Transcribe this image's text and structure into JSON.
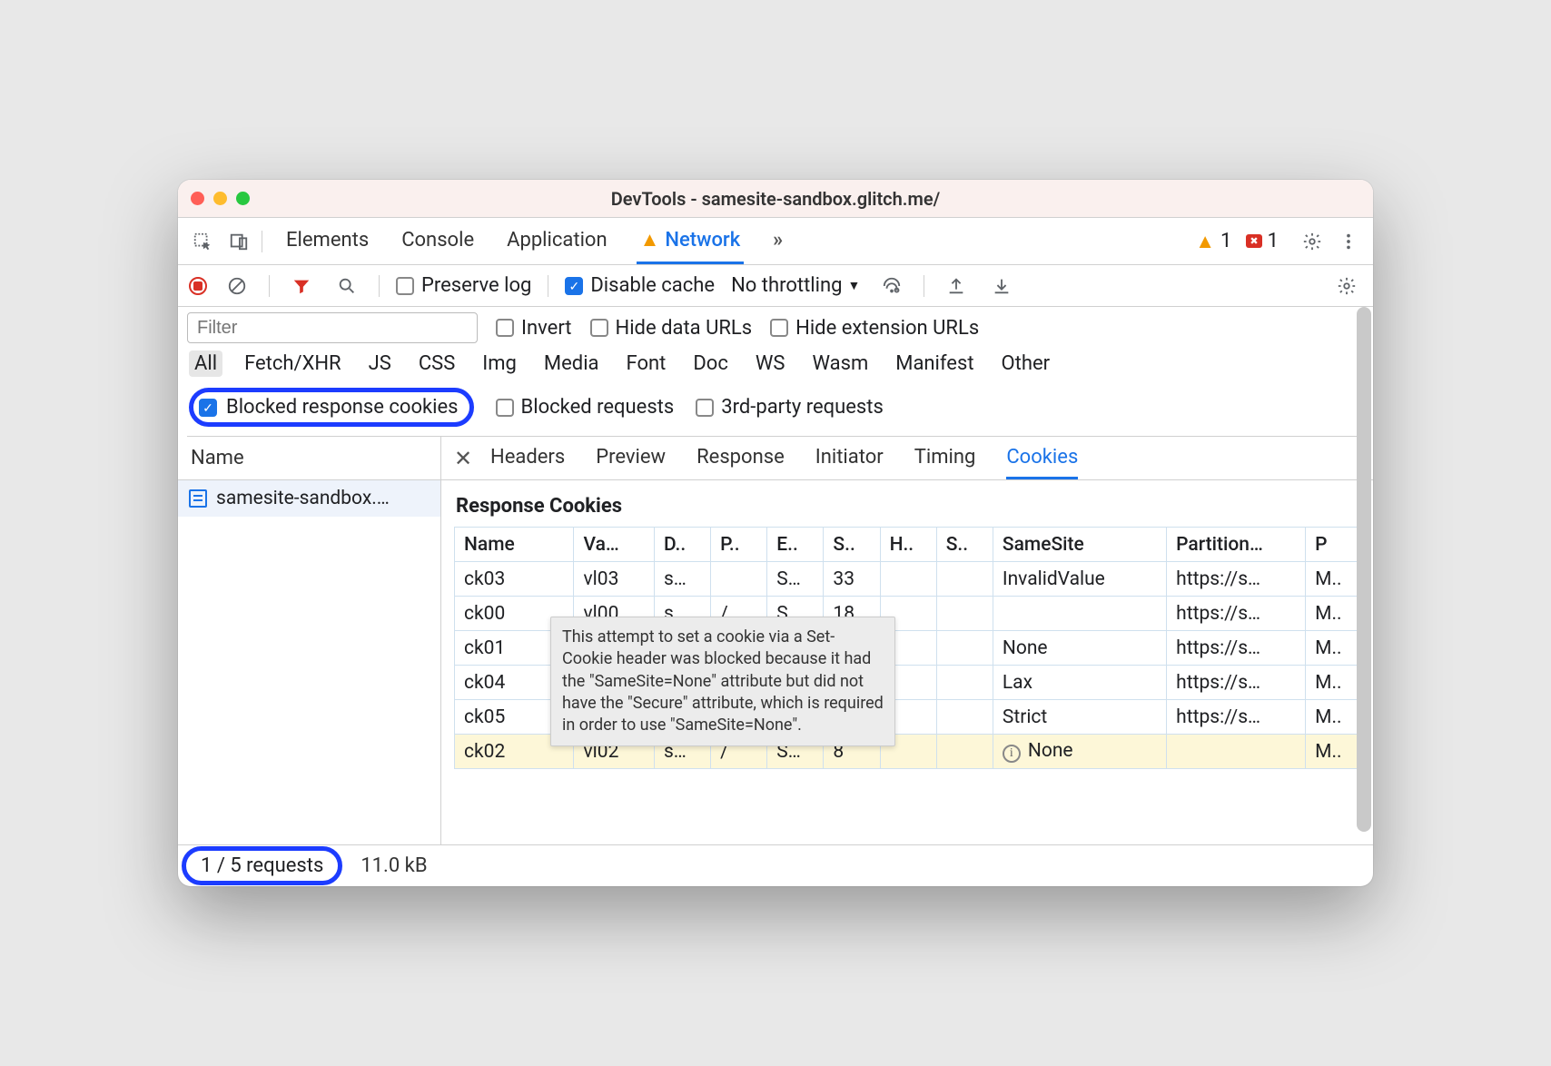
{
  "window": {
    "title": "DevTools - samesite-sandbox.glitch.me/"
  },
  "panel_tabs": {
    "items": [
      "Elements",
      "Console",
      "Application",
      "Network"
    ],
    "active": "Network",
    "more": "»",
    "warn_count": "1",
    "error_count": "1"
  },
  "net_toolbar": {
    "preserve_log": "Preserve log",
    "disable_cache": "Disable cache",
    "throttling": "No throttling"
  },
  "filters": {
    "placeholder": "Filter",
    "invert": "Invert",
    "hide_data_urls": "Hide data URLs",
    "hide_extension_urls": "Hide extension URLs",
    "types": [
      "All",
      "Fetch/XHR",
      "JS",
      "CSS",
      "Img",
      "Media",
      "Font",
      "Doc",
      "WS",
      "Wasm",
      "Manifest",
      "Other"
    ],
    "active_type": "All",
    "blocked_response_cookies": "Blocked response cookies",
    "blocked_requests": "Blocked requests",
    "third_party": "3rd-party requests"
  },
  "request_list": {
    "header": "Name",
    "items": [
      "samesite-sandbox.…"
    ]
  },
  "detail_tabs": {
    "items": [
      "Headers",
      "Preview",
      "Response",
      "Initiator",
      "Timing",
      "Cookies"
    ],
    "active": "Cookies"
  },
  "cookies": {
    "section_title": "Response Cookies",
    "columns": [
      "Name",
      "Va…",
      "D..",
      "P..",
      "E..",
      "S..",
      "H..",
      "S..",
      "SameSite",
      "Partition…",
      "P"
    ],
    "rows": [
      {
        "name": "ck03",
        "value": "vl03",
        "domain": "s…",
        "path": "",
        "expires": "S…",
        "size": "33",
        "http": "",
        "secure": "",
        "samesite": "InvalidValue",
        "partition": "https://s…",
        "priority": "M..",
        "hl": false
      },
      {
        "name": "ck00",
        "value": "vl00",
        "domain": "s…",
        "path": "/",
        "expires": "S…",
        "size": "18",
        "http": "",
        "secure": "",
        "samesite": "",
        "partition": "https://s…",
        "priority": "M..",
        "hl": false
      },
      {
        "name": "ck01",
        "value": "",
        "domain": "",
        "path": "",
        "expires": "",
        "size": "",
        "http": "",
        "secure": "",
        "samesite": "None",
        "partition": "https://s…",
        "priority": "M..",
        "hl": false
      },
      {
        "name": "ck04",
        "value": "",
        "domain": "",
        "path": "",
        "expires": "",
        "size": "",
        "http": "",
        "secure": "",
        "samesite": "Lax",
        "partition": "https://s…",
        "priority": "M..",
        "hl": false
      },
      {
        "name": "ck05",
        "value": "",
        "domain": "",
        "path": "",
        "expires": "",
        "size": "",
        "http": "",
        "secure": "",
        "samesite": "Strict",
        "partition": "https://s…",
        "priority": "M..",
        "hl": false
      },
      {
        "name": "ck02",
        "value": "vl02",
        "domain": "s…",
        "path": "/",
        "expires": "S…",
        "size": "8",
        "http": "",
        "secure": "",
        "samesite": "None",
        "partition": "",
        "priority": "M..",
        "hl": true,
        "warn": true
      }
    ],
    "tooltip": "This attempt to set a cookie via a Set-Cookie header was blocked because it had the \"SameSite=None\" attribute but did not have the \"Secure\" attribute, which is required in order to use \"SameSite=None\"."
  },
  "status": {
    "requests": "1 / 5 requests",
    "transferred": "11.0 kB"
  }
}
